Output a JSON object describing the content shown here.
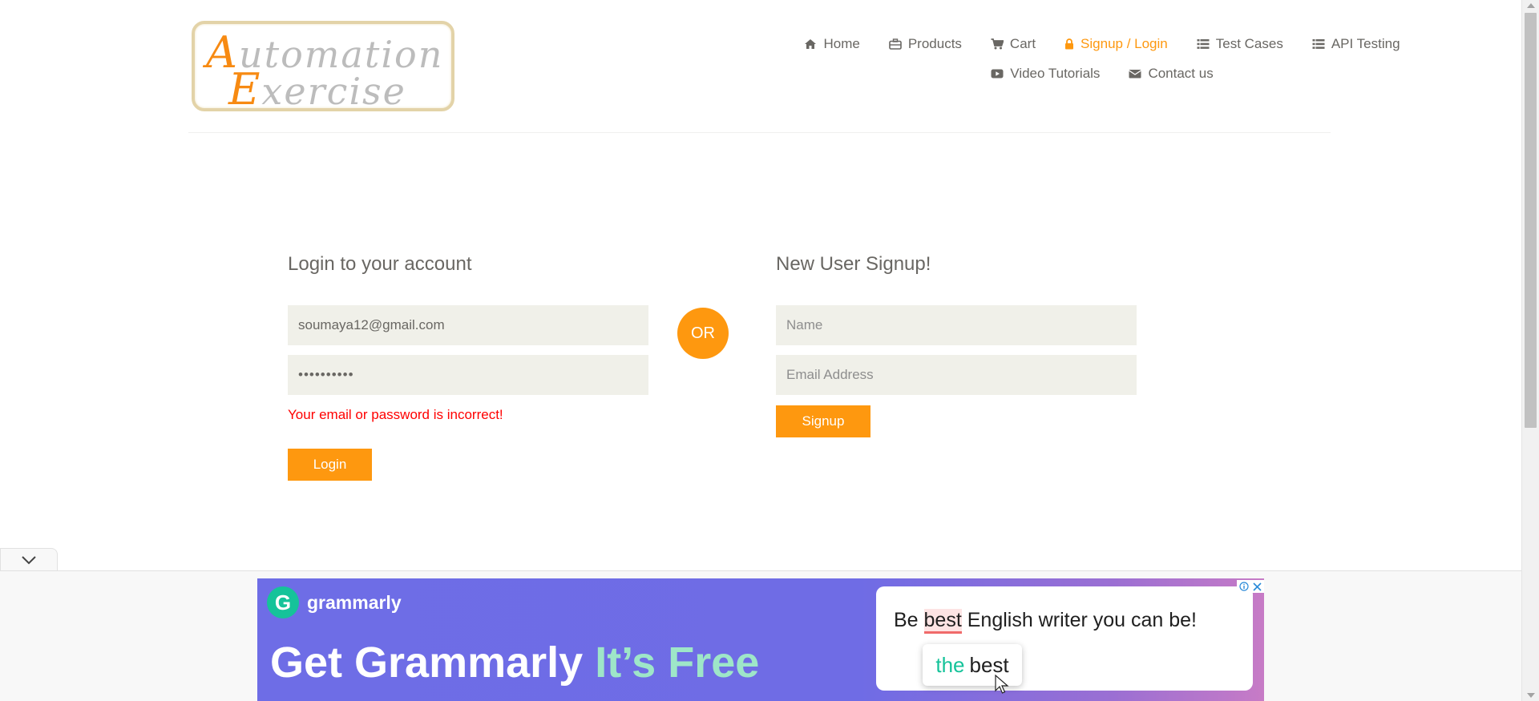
{
  "header": {
    "logo": {
      "line1_cap": "A",
      "line1_rest": "utomation",
      "line2_cap": "E",
      "line2_rest": "xercise"
    },
    "nav": [
      {
        "label": "Home",
        "icon": "home-icon"
      },
      {
        "label": "Products",
        "icon": "products-icon"
      },
      {
        "label": "Cart",
        "icon": "cart-icon"
      },
      {
        "label": "Signup / Login",
        "icon": "lock-icon",
        "active": true
      },
      {
        "label": "Test Cases",
        "icon": "list-icon"
      },
      {
        "label": "API Testing",
        "icon": "list-icon"
      },
      {
        "label": "Video Tutorials",
        "icon": "youtube-play-icon"
      },
      {
        "label": "Contact us",
        "icon": "envelope-icon"
      }
    ]
  },
  "login": {
    "title": "Login to your account",
    "email_value": "soumaya12@gmail.com",
    "password_value": "••••••••••",
    "error": "Your email or password is incorrect!",
    "button": "Login"
  },
  "divider": {
    "label": "OR"
  },
  "signup": {
    "title": "New User Signup!",
    "name_placeholder": "Name",
    "email_placeholder": "Email Address",
    "button": "Signup"
  },
  "ad": {
    "brand": "grammarly",
    "brand_initial": "G",
    "headline_main": "Get Grammarly ",
    "headline_accent": "It’s Free",
    "sentence_before": "Be ",
    "sentence_highlight": "best",
    "sentence_after": " English writer you can be!",
    "suggestion_add": "the",
    "suggestion_word": "best"
  },
  "colors": {
    "accent": "#fe980f",
    "error": "#ff0000",
    "field_bg": "#f0f0e9",
    "ad_purple": "#6e6de6",
    "grammarly_green": "#15c39a"
  }
}
